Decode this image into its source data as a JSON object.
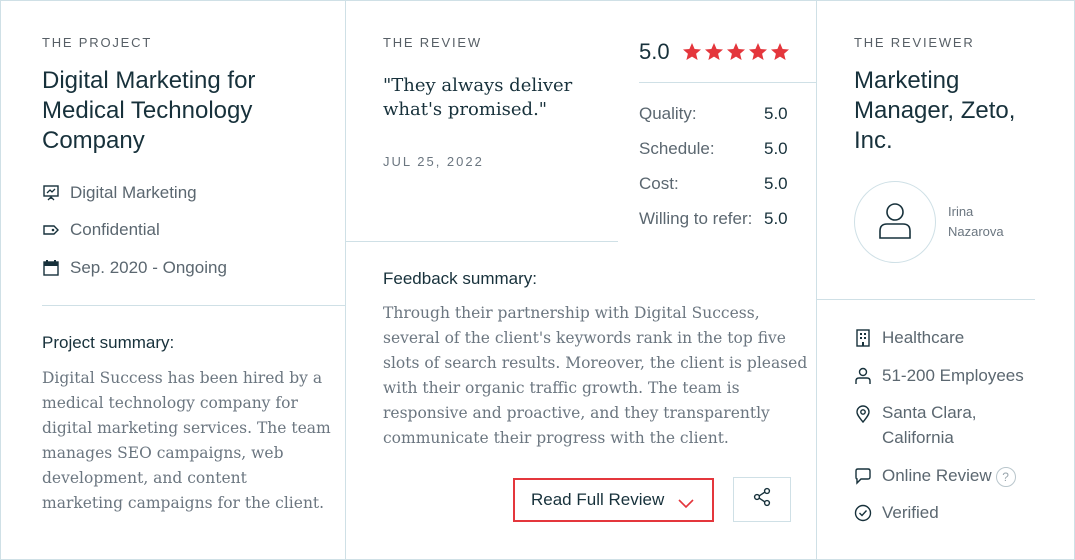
{
  "project": {
    "eyebrow": "THE PROJECT",
    "title_line1": "Digital Marketing for",
    "title_line2": "Medical Technology",
    "title_line3": "Company",
    "service": "Digital Marketing",
    "budget": "Confidential",
    "dates": "Sep. 2020 - Ongoing",
    "summary_heading": "Project summary:",
    "summary_lines": [
      "Digital Success has been hired by a",
      "medical technology company for",
      "digital marketing services. The team",
      "manages SEO campaigns, web",
      "development, and content",
      "marketing campaigns for the client."
    ]
  },
  "review": {
    "eyebrow": "THE REVIEW",
    "quote_line1": "\"They always deliver",
    "quote_line2": "what's promised.\"",
    "date": "JUL 25, 2022",
    "overall": "5.0",
    "star_color": "#e4363c",
    "scores": [
      {
        "label": "Quality:",
        "value": "5.0"
      },
      {
        "label": "Schedule:",
        "value": "5.0"
      },
      {
        "label": "Cost:",
        "value": "5.0"
      },
      {
        "label": "Willing to refer:",
        "value": "5.0"
      }
    ],
    "feedback_heading": "Feedback summary:",
    "feedback_lines": [
      "Through their partnership with Digital Success,",
      "several of the client's keywords rank in the top five",
      "slots of search results. Moreover, the client is pleased",
      "with their organic traffic growth. The team is",
      "responsive and proactive, and they transparently",
      "communicate their progress with the client."
    ],
    "read_full_label": "Read Full Review",
    "share_icon": "share-icon"
  },
  "reviewer": {
    "eyebrow": "THE REVIEWER",
    "title_line1": "Marketing",
    "title_line2": "Manager, Zeto,",
    "title_line3": "Inc.",
    "first_name": "Irina",
    "last_name": "Nazarova",
    "industry": "Healthcare",
    "size": "51-200 Employees",
    "location_line1": "Santa Clara,",
    "location_line2": "California",
    "review_type": "Online Review",
    "help_glyph": "?",
    "verified": "Verified"
  }
}
